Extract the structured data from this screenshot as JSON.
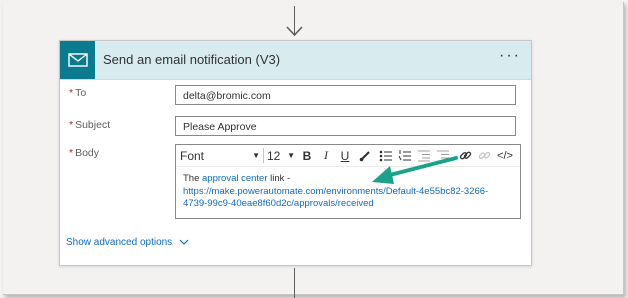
{
  "action": {
    "title": "Send an email notification (V3)",
    "more_label": "···"
  },
  "fields": {
    "to": {
      "label": "To",
      "value": "delta@bromic.com"
    },
    "subject": {
      "label": "Subject",
      "value": "Please Approve"
    },
    "body": {
      "label": "Body",
      "toolbar": {
        "font": "Font",
        "size": "12",
        "bold": "B",
        "italic": "I",
        "underline": "U",
        "code": "</>"
      },
      "text_prefix": "The ",
      "link_text": "approval center",
      "text_suffix": " link -",
      "url_line1": "https://make.powerautomate.com/environments/Default-4e55bc82-3266-",
      "url_line2": "4739-99c9-40eae8f60d2c/approvals/received"
    }
  },
  "required_marker": "*",
  "advanced_options": "Show advanced options",
  "colors": {
    "header_bg": "#d8ecf0",
    "icon_bg": "#0a7b8f",
    "link": "#0f6cbd",
    "annotation_arrow": "#1aa38a"
  },
  "icons": [
    "mail-icon",
    "more-icon",
    "brush-icon",
    "bullet-list-icon",
    "numbered-list-icon",
    "outdent-icon",
    "indent-icon",
    "link-icon",
    "unlink-icon",
    "chevron-down-icon",
    "arrow-down-icon"
  ]
}
